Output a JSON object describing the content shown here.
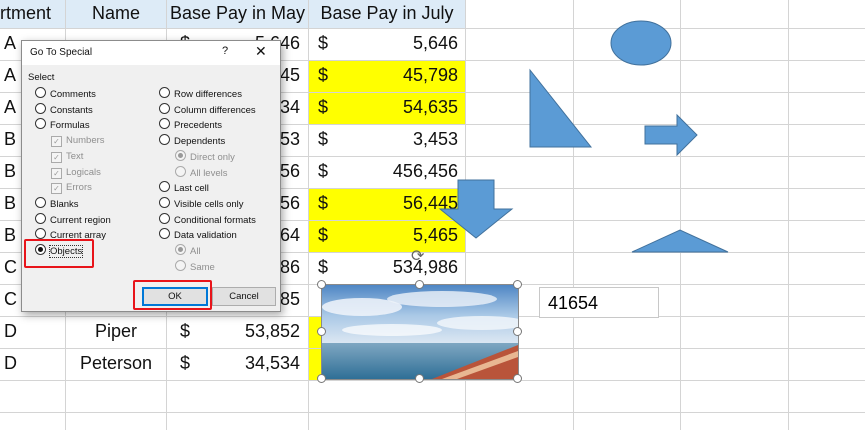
{
  "sheet": {
    "headers": {
      "dept": "rtment",
      "name": "Name",
      "may": "Base Pay in May",
      "july": "Base Pay in July"
    },
    "rows": [
      {
        "dept": "A",
        "name": "",
        "may_cur": "$",
        "may": "5,646",
        "july_cur": "$",
        "july": "5,646"
      },
      {
        "dept": "A",
        "name": "",
        "may_cur": "",
        "may": "45",
        "july_cur": "$",
        "july": "45,798"
      },
      {
        "dept": "A",
        "name": "",
        "may_cur": "",
        "may": "34",
        "july_cur": "$",
        "july": "54,635"
      },
      {
        "dept": "B",
        "name": "",
        "may_cur": "",
        "may": "53",
        "july_cur": "$",
        "july": "3,453"
      },
      {
        "dept": "B",
        "name": "",
        "may_cur": "",
        "may": "56",
        "july_cur": "$",
        "july": "456,456"
      },
      {
        "dept": "B",
        "name": "",
        "may_cur": "",
        "may": "56",
        "july_cur": "$",
        "july": "56,445"
      },
      {
        "dept": "B",
        "name": "",
        "may_cur": "",
        "may": "64",
        "july_cur": "$",
        "july": "5,465"
      },
      {
        "dept": "C",
        "name": "",
        "may_cur": "",
        "may": "86",
        "july_cur": "$",
        "july": "534,986"
      },
      {
        "dept": "C",
        "name": "",
        "may_cur": "",
        "may": "85",
        "july_cur": "",
        "july": ""
      },
      {
        "dept": "D",
        "name": "Piper",
        "may_cur": "$",
        "may": "53,852",
        "july_cur": "",
        "july": ""
      },
      {
        "dept": "D",
        "name": "Peterson",
        "may_cur": "$",
        "may": "34,534",
        "july_cur": "",
        "july": ""
      }
    ],
    "highlight_color": "#ffff00",
    "header_color": "#ddebf7"
  },
  "textbox": {
    "value": "41654"
  },
  "shapes": {
    "fill": "#5b9bd5",
    "stroke": "#41719c",
    "items": [
      "oval",
      "right-triangle",
      "right-arrow",
      "down-arrow",
      "triangle"
    ]
  },
  "dialog": {
    "title": "Go To Special",
    "help": "?",
    "close": "✕",
    "group_label": "Select",
    "left_options": [
      "Comments",
      "Constants",
      "Formulas",
      "Numbers",
      "Text",
      "Logicals",
      "Errors",
      "Blanks",
      "Current region",
      "Current array",
      "Objects"
    ],
    "right_options": [
      "Row differences",
      "Column differences",
      "Precedents",
      "Dependents",
      "Direct only",
      "All levels",
      "Last cell",
      "Visible cells only",
      "Conditional formats",
      "Data validation",
      "All",
      "Same"
    ],
    "selected": "Objects",
    "ok_label": "OK",
    "cancel_label": "Cancel"
  }
}
